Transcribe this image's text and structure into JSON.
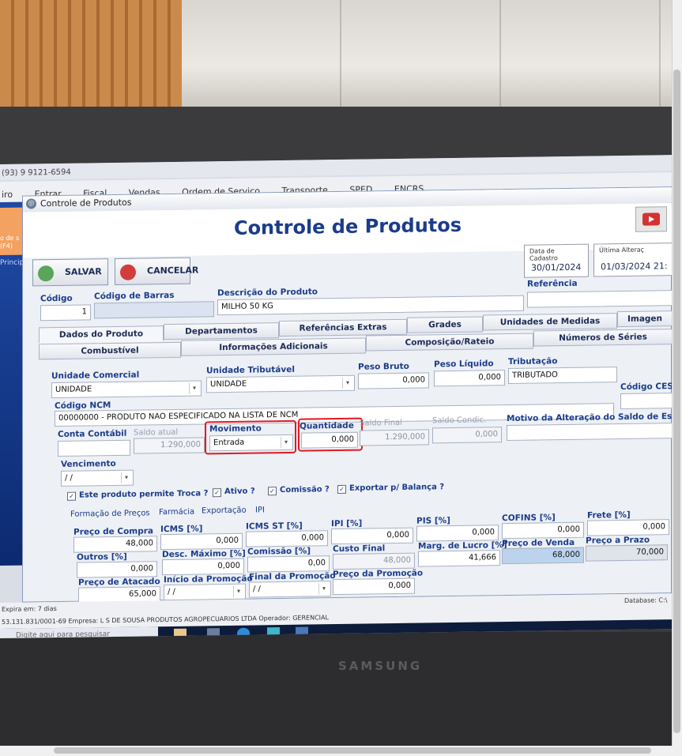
{
  "photo": {
    "brand": "SAMSUNG"
  },
  "desktop": {
    "phone": "(93) 9 9121-6594",
    "menu_left": "iro",
    "menu_items": [
      "Entrar",
      "Fiscal",
      "Vendas",
      "Ordem de Serviço",
      "Transporte",
      "SPED",
      "ENCRS"
    ],
    "left_badge": "o de s (F4)",
    "left_principal": "Principa"
  },
  "window": {
    "title": "Controle de Produtos",
    "heading": "Controle de Produtos",
    "save": "SALVAR",
    "cancel": "CANCELAR",
    "date_cadastro_label": "Data de Cadastro",
    "date_cadastro": "30/01/2024",
    "ultima_label": "Última Alteraç",
    "ultima": "01/03/2024 21:"
  },
  "product": {
    "codigo_label": "Código",
    "codigo": "1",
    "barras_label": "Código de Barras",
    "barras": "",
    "descricao_label": "Descrição do Produto",
    "descricao": "MILHO 50 KG",
    "referencia_label": "Referência",
    "referencia": ""
  },
  "tabs_row1": [
    "Dados do Produto",
    "Departamentos",
    "Referências Extras",
    "Grades",
    "Unidades de Medidas",
    "Imagen"
  ],
  "tabs_row2": [
    "Combustível",
    "Informações Adicionais",
    "Composição/Rateio",
    "Números de Séries"
  ],
  "fields": {
    "un_comercial_label": "Unidade Comercial",
    "un_comercial": "UNIDADE",
    "un_tributavel_label": "Unidade Tributável",
    "un_tributavel": "UNIDADE",
    "peso_bruto_label": "Peso Bruto",
    "peso_bruto": "0,000",
    "peso_liquido_label": "Peso Líquido",
    "peso_liquido": "0,000",
    "tributacao_label": "Tributação",
    "tributacao": "TRIBUTADO",
    "ncm_label": "Código NCM",
    "ncm": "00000000 - PRODUTO NAO ESPECIFICADO NA LISTA DE NCM",
    "cest_label": "Código CEST",
    "conta_label": "Conta Contábil",
    "saldo_atual_label": "Saldo atual",
    "saldo_atual": "1.290,000",
    "movimento_label": "Movimento",
    "movimento": "Entrada",
    "quantidade_label": "Quantidade",
    "quantidade": "0,000",
    "saldo_final_label": "Saldo Final",
    "saldo_final": "1.290,000",
    "saldo_condic_label": "Saldo Condic.",
    "saldo_condic": "0,000",
    "motivo_label": "Motivo da Alteração do Saldo de Estoque",
    "vencimento_label": "Vencimento",
    "vencimento": "/ /"
  },
  "checks": {
    "troca": "Este produto permite Troca ?",
    "ativo": "Ativo ?",
    "comissao": "Comissão ?",
    "exportar": "Exportar p/ Balança ?"
  },
  "subtabs": [
    "Formação de Preços",
    "Farmácia",
    "Exportação",
    "IPI"
  ],
  "prices": {
    "preco_compra_label": "Preço de Compra",
    "preco_compra": "48,000",
    "icms_label": "ICMS [%]",
    "icms": "0,000",
    "icms_st_label": "ICMS ST [%]",
    "icms_st": "0,000",
    "ipi_label": "IPI [%]",
    "ipi": "0,000",
    "pis_label": "PIS [%]",
    "pis": "0,000",
    "cofins_label": "COFINS [%]",
    "cofins": "0,000",
    "frete_label": "Frete [%]",
    "frete": "0,000",
    "outros_label": "Outros [%]",
    "outros": "0,000",
    "desc_max_label": "Desc. Máximo [%]",
    "desc_max": "0,000",
    "comissao_label": "Comissão [%]",
    "comissao": "0,00",
    "custo_final_label": "Custo Final",
    "custo_final": "48,000",
    "marg_lucro_label": "Marg. de Lucro [%]",
    "marg_lucro": "41,666",
    "preco_venda_label": "Preço de Venda",
    "preco_venda": "68,000",
    "preco_prazo_label": "Preço a Prazo",
    "preco_prazo": "70,000",
    "preco_atacado_label": "Preço de Atacado",
    "preco_atacado": "65,000",
    "inicio_promo_label": "Início da Promoção",
    "inicio_promo": "/ /",
    "final_promo_label": "Final da Promoção",
    "final_promo": "/ /",
    "preco_promo_label": "Preço da Promoção",
    "preco_promo": "0,000"
  },
  "status": {
    "expira": "Expira em: 7 dias",
    "empresa": "53.131.831/0001-69   Empresa: L S DE SOUSA PRODUTOS AGROPECUARIOS LTDA   Operador: GERENCIAL",
    "database": "Database: C:\\",
    "search": "Digite aqui para pesquisar"
  },
  "colors": {
    "accent": "#1b3c8b",
    "highlight": "#e01a22",
    "price_sale": "#bcd3ee"
  }
}
